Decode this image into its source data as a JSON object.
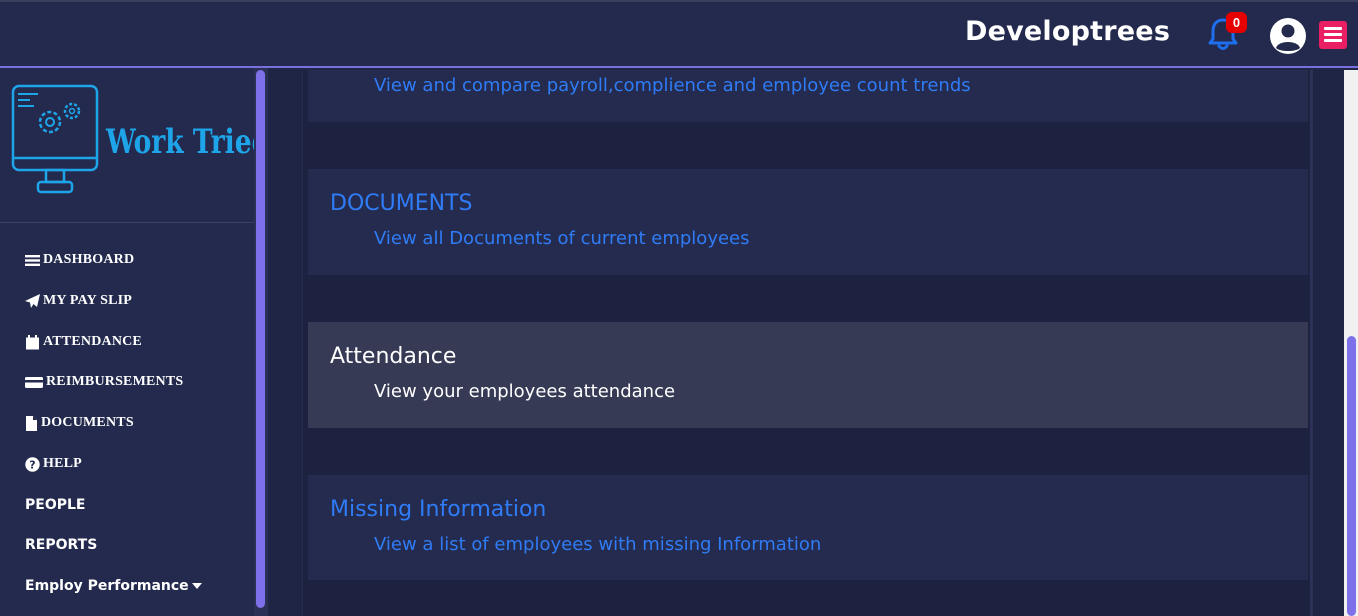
{
  "header": {
    "brand": "Developtrees",
    "notification_count": "0",
    "icons": {
      "bell": "bell-icon",
      "user": "user-circle-icon",
      "menu": "hamburger-menu-icon"
    },
    "colors": {
      "bell": "#1e6ff0",
      "badge": "#e60000",
      "menu": "#e91e63"
    }
  },
  "sidebar": {
    "logo_text": "Work Tried",
    "items": [
      {
        "label": "DASHBOARD",
        "icon": "bars-icon"
      },
      {
        "label": "MY PAY SLIP",
        "icon": "paper-plane-icon"
      },
      {
        "label": "ATTENDANCE",
        "icon": "calendar-icon"
      },
      {
        "label": "REIMBURSEMENTS",
        "icon": "credit-card-icon"
      },
      {
        "label": "DOCUMENTS",
        "icon": "file-icon"
      },
      {
        "label": "HELP",
        "icon": "question-circle-icon"
      },
      {
        "label": "PEOPLE"
      },
      {
        "label": "REPORTS"
      },
      {
        "label": "Employ Performance",
        "icon": "caret-down-icon"
      }
    ]
  },
  "main": {
    "cards": [
      {
        "title": "",
        "description": "View and compare payroll,complience and employee count trends"
      },
      {
        "title": "DOCUMENTS",
        "description": "View all Documents of current employees"
      },
      {
        "title": "Attendance",
        "description": "View your employees attendance",
        "active": true
      },
      {
        "title": "Missing Information",
        "description": "View a list of employees with missing Information"
      }
    ]
  },
  "colors": {
    "accent": "#7d70e8",
    "link": "#2f7cf6",
    "background": "#1f2545"
  }
}
